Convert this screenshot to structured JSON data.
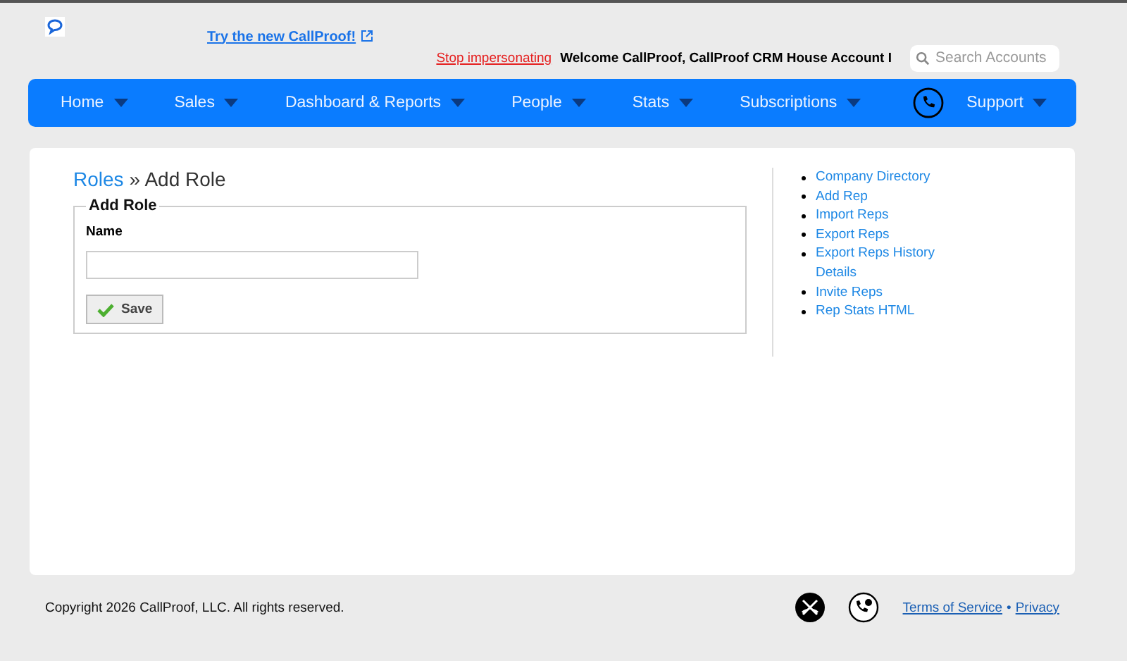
{
  "top_link": "Try the new CallProof!",
  "stop_link": "Stop impersonating",
  "welcome": "Welcome CallProof, CallProof CRM House Account I",
  "search": {
    "placeholder": "Search Accounts"
  },
  "nav": [
    {
      "label": "Home",
      "kind": "menu"
    },
    {
      "label": "Sales",
      "kind": "menu"
    },
    {
      "label": "Dashboard & Reports",
      "kind": "menu"
    },
    {
      "label": "People",
      "kind": "menu"
    },
    {
      "label": "Stats",
      "kind": "menu"
    },
    {
      "label": "Subscriptions",
      "kind": "menu"
    },
    {
      "kind": "phone"
    },
    {
      "label": "Support",
      "kind": "menu"
    }
  ],
  "breadcrumb": {
    "parent": "Roles",
    "separator": "»",
    "current": "Add Role"
  },
  "form": {
    "legend": "Add Role",
    "field_label": "Name",
    "save": "Save"
  },
  "sidebar_links": [
    "Company Directory",
    "Add Rep",
    "Import Reps",
    "Export Reps",
    "Export Reps History Details",
    "Invite Reps",
    "Rep Stats HTML"
  ],
  "footer": {
    "copyright": "Copyright 2026 CallProof, LLC. All rights reserved.",
    "links": [
      "Terms of Service",
      "Privacy"
    ],
    "separator": "•"
  }
}
